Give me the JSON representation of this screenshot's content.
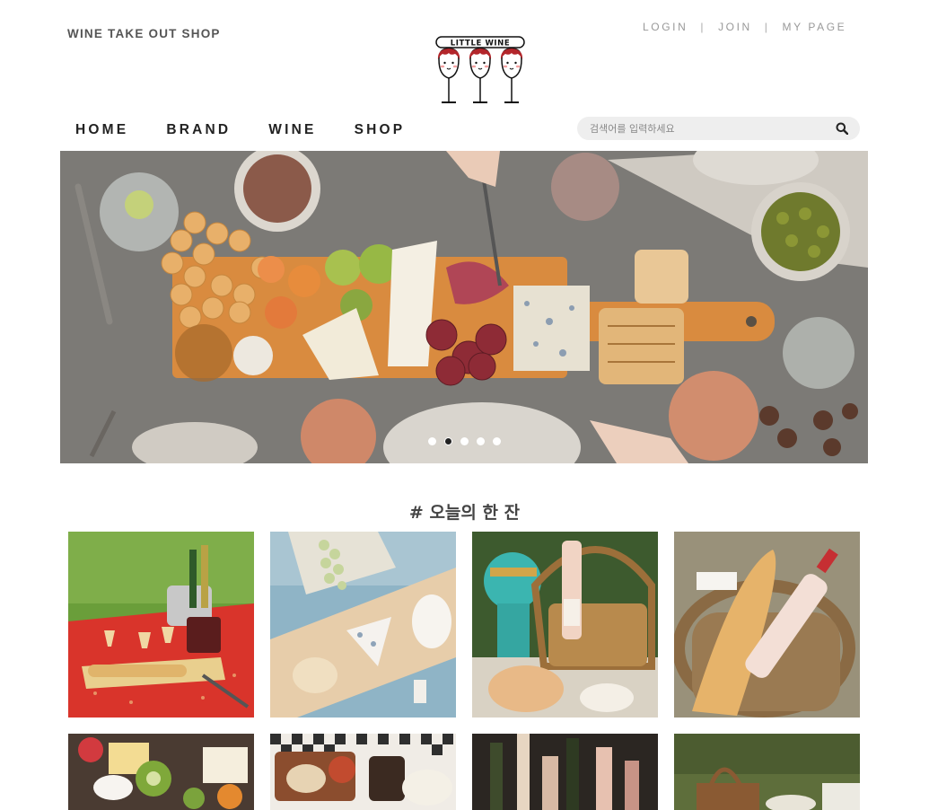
{
  "header": {
    "shop_title": "WINE TAKE OUT SHOP",
    "user_links": [
      "LOGIN",
      "JOIN",
      "MY PAGE"
    ],
    "separator": "|",
    "logo_text": "LITTLE WINE"
  },
  "nav": {
    "items": [
      "HOME",
      "BRAND",
      "WINE",
      "SHOP"
    ]
  },
  "search": {
    "placeholder": "검색어를 입력하세요",
    "icon": "search-icon"
  },
  "hero": {
    "slide_count": 5,
    "active_index": 1
  },
  "section": {
    "title": "# 오늘의 한 잔"
  },
  "colors": {
    "search_bg": "#eeeeee",
    "tile_red_blanket": "#d9342b",
    "tile_blue_table": "#8fb4c6",
    "tile_teal_bust": "#3bb5b0"
  }
}
